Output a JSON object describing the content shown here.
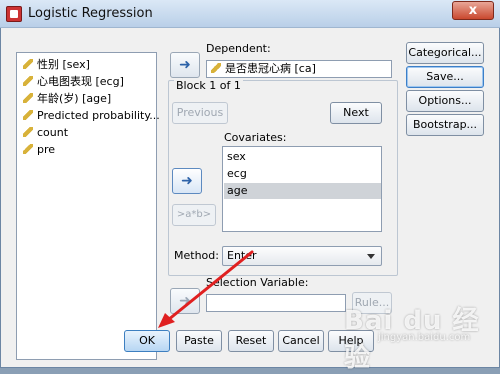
{
  "window": {
    "title": "Logistic Regression",
    "close": "x"
  },
  "variables": [
    {
      "label": "性别 [sex]",
      "icon": "pencil-icon"
    },
    {
      "label": "心电图表现 [ecg]",
      "icon": "pencil-icon"
    },
    {
      "label": "年龄(岁) [age]",
      "icon": "pencil-icon"
    },
    {
      "label": "Predicted probability...",
      "icon": "pencil-icon"
    },
    {
      "label": "count",
      "icon": "pencil-icon"
    },
    {
      "label": "pre",
      "icon": "pencil-icon"
    }
  ],
  "dependent": {
    "label": "Dependent:",
    "value": "是否患冠心病 [ca]"
  },
  "block": {
    "label": "Block 1 of 1",
    "previous": "Previous",
    "next": "Next"
  },
  "covariates": {
    "label": "Covariates:",
    "items": [
      "sex",
      "ecg",
      "age"
    ],
    "selected_index": 2
  },
  "interaction_button": ">a*b>",
  "method": {
    "label": "Method:",
    "value": "Enter"
  },
  "selection_variable": {
    "label": "Selection Variable:",
    "rule": "Rule..."
  },
  "side_buttons": {
    "categorical": "Categorical...",
    "save": "Save...",
    "options": "Options...",
    "bootstrap": "Bootstrap..."
  },
  "footer_buttons": {
    "ok": "OK",
    "paste": "Paste",
    "reset": "Reset",
    "cancel": "Cancel",
    "help": "Help"
  },
  "watermark": {
    "logo": "Bai du 经验",
    "url": "jingyan.baidu.com"
  },
  "colors": {
    "annotation_arrow": "#e02020",
    "title_gradient_top": "#dbe8f6",
    "selected_row": "#cfd3d8"
  }
}
